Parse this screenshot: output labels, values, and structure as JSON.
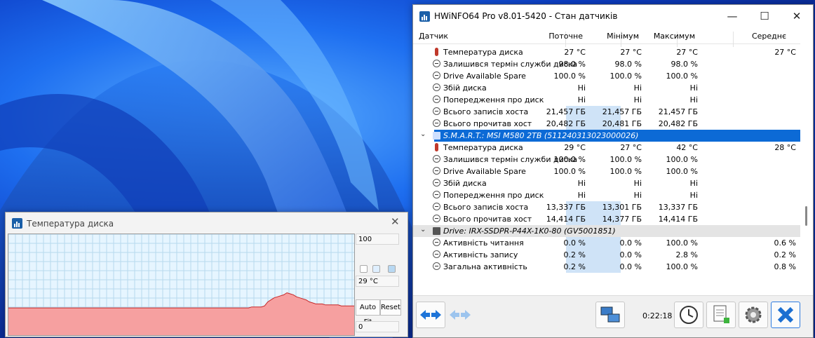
{
  "main_window": {
    "title": "HWiNFO64 Pro v8.01-5420 - Стан датчиків",
    "controls": {
      "minimize": "—",
      "maximize": "☐",
      "close": "✕"
    },
    "columns": {
      "sensor": "Датчик",
      "current": "Поточне",
      "min": "Мінімум",
      "max": "Максимум",
      "avg": "Середнє"
    },
    "elapsed": "0:22:18"
  },
  "rows": [
    {
      "icon": "thermometer-icon",
      "label": "Температура диска",
      "cur": "27 °C",
      "min": "27 °C",
      "max": "27 °C",
      "avg": "27 °C",
      "hl": false
    },
    {
      "icon": "clock-icon",
      "label": "Залишився термін служби диска",
      "cur": "98.0 %",
      "min": "98.0 %",
      "max": "98.0 %",
      "avg": "",
      "hl": false
    },
    {
      "icon": "clock-icon",
      "label": "Drive Available Spare",
      "cur": "100.0 %",
      "min": "100.0 %",
      "max": "100.0 %",
      "avg": "",
      "hl": false
    },
    {
      "icon": "clock-icon",
      "label": "Збій диска",
      "cur": "Ні",
      "min": "Ні",
      "max": "Ні",
      "avg": "",
      "hl": false
    },
    {
      "icon": "clock-icon",
      "label": "Попередження про диск",
      "cur": "Ні",
      "min": "Ні",
      "max": "Ні",
      "avg": "",
      "hl": false
    },
    {
      "icon": "clock-icon",
      "label": "Всього записів хоста",
      "cur": "21,457 ГБ",
      "min": "21,457 ГБ",
      "max": "21,457 ГБ",
      "avg": "",
      "hl": true
    },
    {
      "icon": "clock-icon",
      "label": "Всього прочитав хост",
      "cur": "20,482 ГБ",
      "min": "20,481 ГБ",
      "max": "20,482 ГБ",
      "avg": "",
      "hl": true
    },
    {
      "group": true,
      "selected": true,
      "icon": "chip-icon",
      "label": "S.M.A.R.T.: MSI M580 2TB (511240313023000026)"
    },
    {
      "icon": "thermometer-icon",
      "label": "Температура диска",
      "cur": "29 °C",
      "min": "27 °C",
      "max": "42 °C",
      "avg": "28 °C",
      "hl": false
    },
    {
      "icon": "clock-icon",
      "label": "Залишився термін служби диска",
      "cur": "100.0 %",
      "min": "100.0 %",
      "max": "100.0 %",
      "avg": "",
      "hl": false
    },
    {
      "icon": "clock-icon",
      "label": "Drive Available Spare",
      "cur": "100.0 %",
      "min": "100.0 %",
      "max": "100.0 %",
      "avg": "",
      "hl": false
    },
    {
      "icon": "clock-icon",
      "label": "Збій диска",
      "cur": "Ні",
      "min": "Ні",
      "max": "Ні",
      "avg": "",
      "hl": false
    },
    {
      "icon": "clock-icon",
      "label": "Попередження про диск",
      "cur": "Ні",
      "min": "Ні",
      "max": "Ні",
      "avg": "",
      "hl": false
    },
    {
      "icon": "clock-icon",
      "label": "Всього записів хоста",
      "cur": "13,337 ГБ",
      "min": "13,301 ГБ",
      "max": "13,337 ГБ",
      "avg": "",
      "hl": true
    },
    {
      "icon": "clock-icon",
      "label": "Всього прочитав хост",
      "cur": "14,414 ГБ",
      "min": "14,377 ГБ",
      "max": "14,414 ГБ",
      "avg": "",
      "hl": true
    },
    {
      "group": true,
      "selected": false,
      "icon": "drive-icon",
      "label": "Drive: IRX-SSDPR-P44X-1K0-80 (GV5001851)"
    },
    {
      "icon": "clock-icon",
      "label": "Активність читання",
      "cur": "0.0 %",
      "min": "0.0 %",
      "max": "100.0 %",
      "avg": "0.6 %",
      "hl": true
    },
    {
      "icon": "clock-icon",
      "label": "Активність запису",
      "cur": "0.2 %",
      "min": "0.0 %",
      "max": "2.8 %",
      "avg": "0.2 %",
      "hl": true
    },
    {
      "icon": "clock-icon",
      "label": "Загальна активність",
      "cur": "0.2 %",
      "min": "0.0 %",
      "max": "100.0 %",
      "avg": "0.8 %",
      "hl": true
    }
  ],
  "graph_window": {
    "title": "Температура диска",
    "max_label": "100",
    "current_label": "29 °C",
    "min_label": "0",
    "auto_fit": "Auto Fit",
    "reset": "Reset",
    "series_color": "#f6a0a0",
    "chart_data": {
      "type": "area",
      "ylim": [
        0,
        100
      ],
      "values": [
        27,
        27,
        27,
        27,
        27,
        27,
        27,
        27,
        27,
        27,
        27,
        27,
        27,
        27,
        27,
        27,
        27,
        27,
        27,
        27,
        27,
        27,
        27,
        27,
        27,
        27,
        27,
        27,
        27,
        27,
        27,
        27,
        27,
        27,
        27,
        27,
        27,
        27,
        27,
        27,
        27,
        27,
        27,
        27,
        27,
        27,
        27,
        27,
        27,
        27,
        27,
        27,
        27,
        27,
        27,
        27,
        27,
        27,
        27,
        27,
        27,
        27,
        27,
        27,
        27,
        27,
        27,
        27,
        27,
        27,
        27,
        27,
        27,
        27,
        27,
        27,
        28,
        28,
        28,
        28,
        29,
        33,
        35,
        37,
        38,
        39,
        40,
        42,
        41,
        40,
        38,
        37,
        36,
        35,
        33,
        32,
        31,
        31,
        31,
        30,
        30,
        30,
        30,
        30,
        29,
        29,
        29,
        29,
        29
      ]
    }
  }
}
